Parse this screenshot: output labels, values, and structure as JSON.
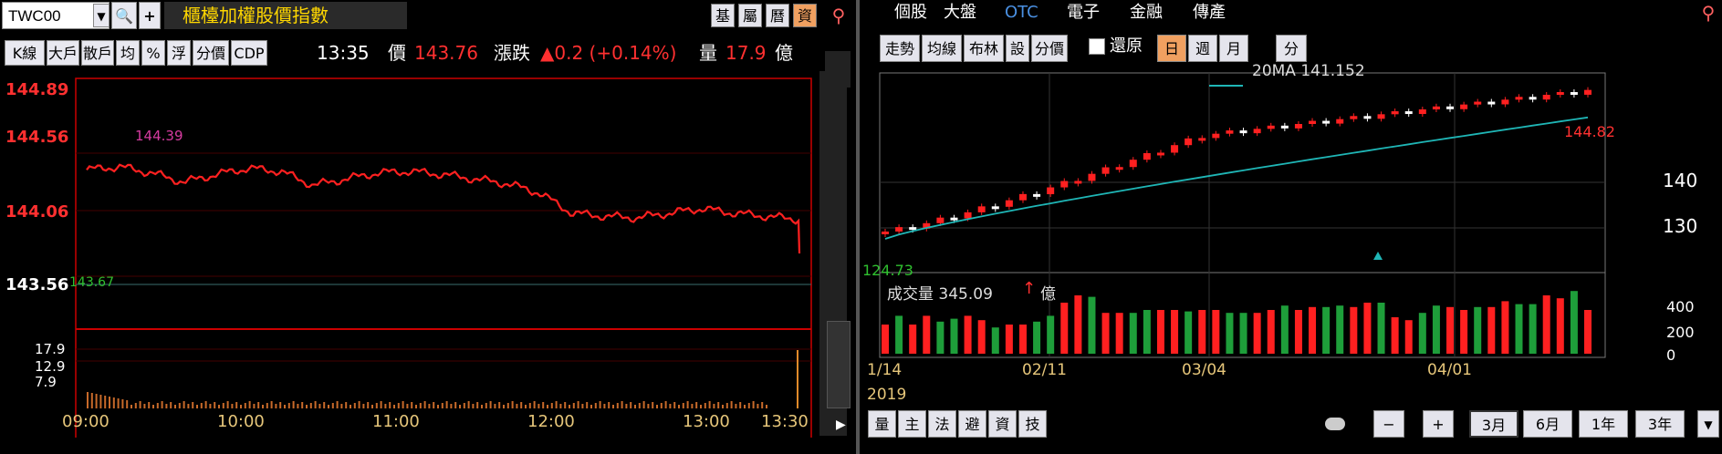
{
  "left": {
    "symbol": "TWC00",
    "title": "櫃檯加權股價指數",
    "top_right_buttons": [
      {
        "label": "基",
        "active": false
      },
      {
        "label": "屬",
        "active": false
      },
      {
        "label": "曆",
        "active": false
      },
      {
        "label": "資",
        "active": true
      }
    ],
    "toolbar": [
      "K線",
      "大戶",
      "散戶",
      "均",
      "%",
      "浮",
      "分價",
      "CDP"
    ],
    "time": "13:35",
    "price_label": "價",
    "price": "143.76",
    "change_label": "漲跌",
    "change": "▲0.2 (+0.14%)",
    "volume_label": "量",
    "volume": "17.9",
    "volume_unit": "億",
    "price_levels": [
      "144.89",
      "144.56",
      "144.06",
      "143.56"
    ],
    "ref_label": "143.67",
    "high_label": "144.39",
    "vol_levels": [
      "17.9",
      "12.9",
      "7.9"
    ],
    "time_ticks": [
      "09:00",
      "10:00",
      "11:00",
      "12:00",
      "13:00",
      "13:30"
    ]
  },
  "right": {
    "tabs": [
      {
        "label": "個股",
        "selected": false
      },
      {
        "label": "大盤",
        "selected": false
      },
      {
        "label": "OTC",
        "selected": true
      },
      {
        "label": "電子",
        "selected": false
      },
      {
        "label": "金融",
        "selected": false
      },
      {
        "label": "傳產",
        "selected": false
      }
    ],
    "toolbar": [
      "走勢",
      "均線",
      "布林",
      "設",
      "分價"
    ],
    "restore_label": "還原",
    "period_buttons": [
      {
        "label": "日",
        "active": true
      },
      {
        "label": "週",
        "active": false
      },
      {
        "label": "月",
        "active": false
      }
    ],
    "minute_label": "分",
    "ma_legend": "20MA 141.152",
    "high_label": "144.82",
    "low_label": "124.73",
    "price_ticks": [
      "140",
      "130"
    ],
    "volume_legend": "成交量 345.09",
    "volume_arrow": "↑",
    "volume_unit": "億",
    "vol_ticks": [
      "400",
      "200",
      "0"
    ],
    "date_ticks": [
      "1/14",
      "02/11",
      "03/04",
      "04/01"
    ],
    "year": "2019",
    "bottom_tabs": [
      "量",
      "主",
      "法",
      "避",
      "資",
      "技"
    ],
    "range_buttons": [
      {
        "label": "3月",
        "active": true
      },
      {
        "label": "6月",
        "active": false
      },
      {
        "label": "1年",
        "active": false
      },
      {
        "label": "3年",
        "active": false
      }
    ]
  },
  "chart_data": [
    {
      "type": "line",
      "title": "櫃檯加權股價指數",
      "series": [
        {
          "name": "price",
          "x": [
            "09:00",
            "09:30",
            "10:00",
            "10:30",
            "11:00",
            "11:30",
            "12:00",
            "12:30",
            "13:00",
            "13:30"
          ],
          "values": [
            144.3,
            144.32,
            144.25,
            144.29,
            144.26,
            144.2,
            144.0,
            143.99,
            144.02,
            143.97
          ]
        }
      ],
      "ylim": [
        143.56,
        144.89
      ],
      "colors": {
        "price": "#ff2020"
      }
    },
    {
      "type": "bar",
      "title": "成交量",
      "categories": [
        "1/14",
        "02/11",
        "03/04",
        "04/01"
      ],
      "values_approx_daily": [
        200,
        260,
        200,
        260,
        220,
        240,
        260,
        230,
        180,
        200,
        200,
        220,
        260,
        350,
        400,
        390,
        280,
        280,
        280,
        300,
        300,
        300,
        290,
        300,
        300,
        280,
        280,
        280,
        300,
        330,
        300,
        320,
        320,
        330,
        320,
        350,
        350,
        250,
        230,
        280,
        330,
        320,
        300,
        320,
        320,
        360,
        340,
        340,
        400,
        380,
        430,
        300
      ],
      "ylim": [
        0,
        450
      ]
    },
    {
      "type": "line",
      "title": "20MA",
      "ma_start": 124.5,
      "ma_end": 141.152,
      "close_start": 125.5,
      "close_end": 144.82,
      "ylim": [
        120,
        147
      ]
    }
  ]
}
